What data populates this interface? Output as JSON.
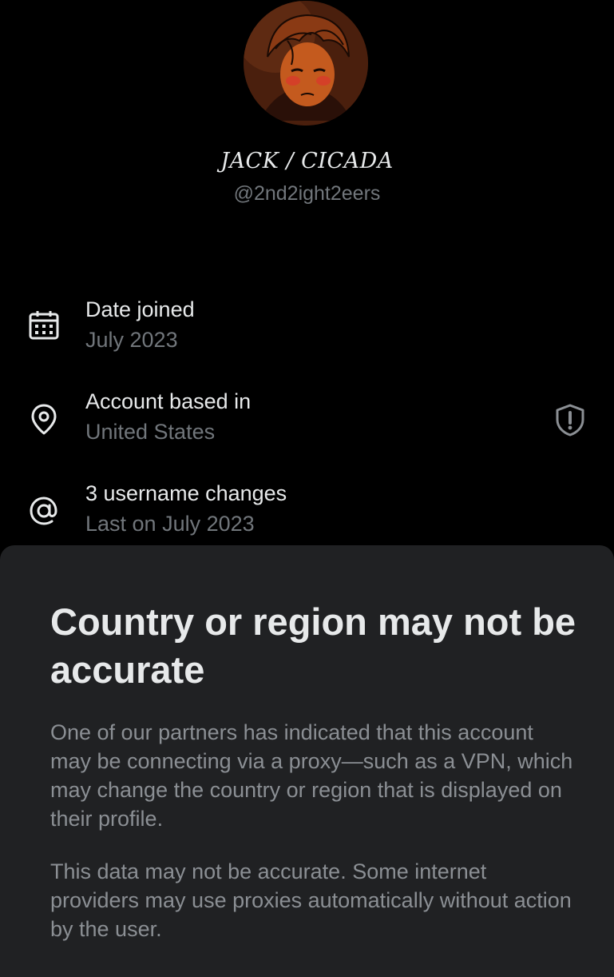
{
  "profile": {
    "display_name": "JACK / CICADA",
    "handle": "@2nd2ight2eers"
  },
  "info": [
    {
      "icon": "calendar-icon",
      "title": "Date joined",
      "value": "July 2023"
    },
    {
      "icon": "location-pin-icon",
      "title": "Account based in",
      "value": "United States",
      "action_icon": "shield-alert-icon"
    },
    {
      "icon": "at-sign-icon",
      "title": "3 username changes",
      "value": "Last on July 2023"
    }
  ],
  "sheet": {
    "title": "Country or region may not be accurate",
    "paragraphs": [
      "One of our partners has indicated that this account may be connecting via a proxy—such as a VPN, which may change the country or region that is displayed on their profile.",
      "This data may not be accurate. Some internet providers may use proxies automatically without action by the user."
    ]
  },
  "colors": {
    "background": "#000000",
    "primary_text": "#e7e9ea",
    "secondary_text": "#71767b",
    "sheet_background": "#202123"
  }
}
